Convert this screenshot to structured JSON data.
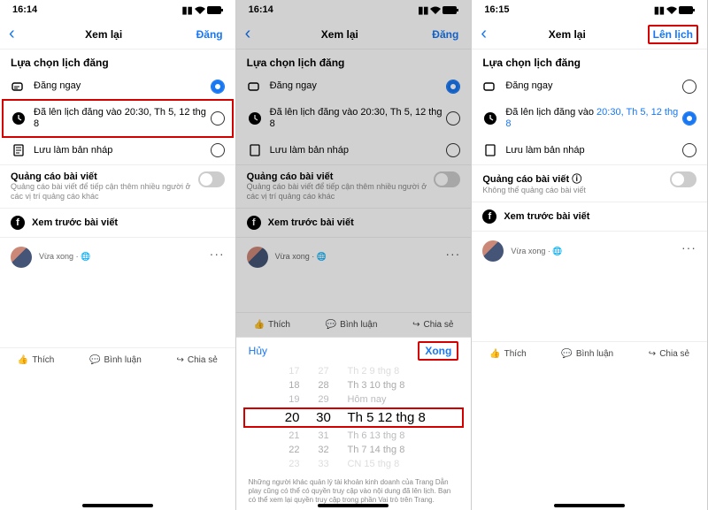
{
  "statusbar": {
    "time1": "16:14",
    "time2": "16:14",
    "time3": "16:15"
  },
  "nav": {
    "title": "Xem lại",
    "publish": "Đăng",
    "schedule": "Lên lịch"
  },
  "sections": {
    "schedule_header": "Lựa chọn lịch đăng",
    "post_now": "Đăng ngay",
    "scheduled_prefix": "Đã lên lịch đăng vào ",
    "scheduled_time": "20:30, Th 5, 12 thg 8",
    "save_draft": "Lưu làm bản nháp"
  },
  "promo": {
    "title": "Quảng cáo bài viết",
    "sub_allowed": "Quảng cáo bài viết để tiếp cận thêm nhiều người ở các vị trí quảng cáo khác",
    "sub_disallowed": "Không thể quảng cáo bài viết"
  },
  "preview": {
    "label": "Xem trước bài viết"
  },
  "post": {
    "meta_time": "Vừa xong",
    "like": "Thích",
    "comment": "Bình luận",
    "share": "Chia sẻ"
  },
  "picker": {
    "cancel": "Hủy",
    "done": "Xong",
    "rows": [
      {
        "h": "17",
        "m": "27",
        "d": "Th 2 9 thg 8"
      },
      {
        "h": "18",
        "m": "28",
        "d": "Th 3 10 thg 8"
      },
      {
        "h": "19",
        "m": "29",
        "d": "Hôm nay"
      },
      {
        "h": "20",
        "m": "30",
        "d": "Th 5 12 thg 8"
      },
      {
        "h": "21",
        "m": "31",
        "d": "Th 6 13 thg 8"
      },
      {
        "h": "22",
        "m": "32",
        "d": "Th 7 14 thg 8"
      },
      {
        "h": "23",
        "m": "33",
        "d": "CN 15 thg 8"
      }
    ]
  },
  "footnote": "Những người khác quản lý tài khoản kinh doanh của Trang Dẫn play cũng có thể có quyền truy cập vào nội dung đã lên lịch. Bạn có thể xem lại quyền truy cập trong phần Vai trò trên Trang."
}
